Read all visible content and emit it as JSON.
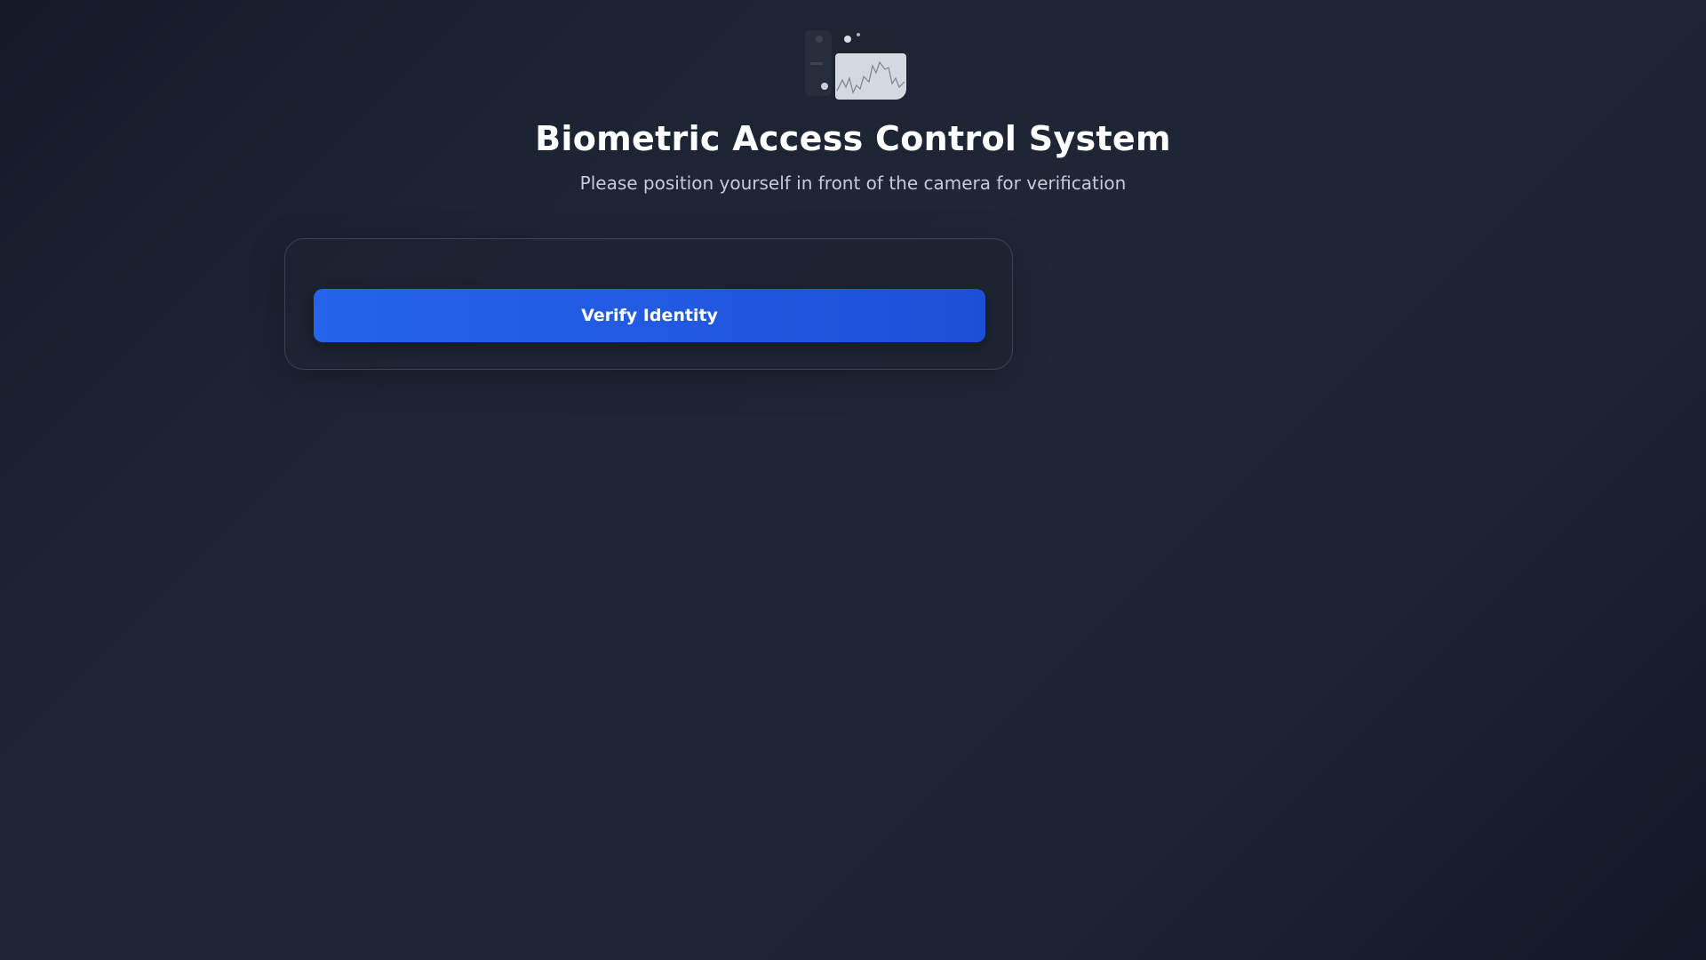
{
  "header": {
    "logo_icon": "camera-feed-thumbnail",
    "title": "Biometric Access Control System",
    "subtitle": "Please position yourself in front of the camera for verification"
  },
  "verification": {
    "button_label": "Verify Identity"
  },
  "colors": {
    "accent": "#2563eb",
    "background": "#1b2232",
    "title": "#ffffff",
    "subtitle": "#c4cbd6"
  }
}
